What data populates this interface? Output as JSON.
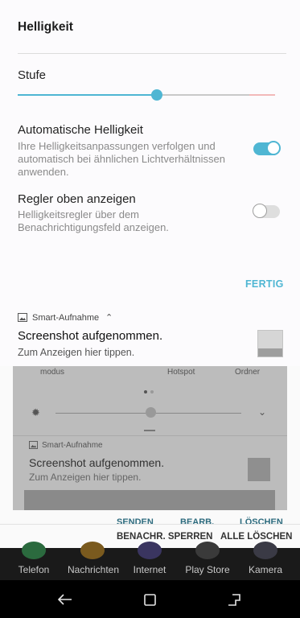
{
  "brightness": {
    "title": "Helligkeit",
    "level_label": "Stufe",
    "level": 0.55,
    "auto": {
      "label": "Automatische Helligkeit",
      "description": "Ihre Helligkeitsanpassungen verfolgen und automatisch bei ähnlichen Lichtverhältnissen anwenden.",
      "enabled": true
    },
    "top_slider": {
      "label": "Regler oben anzeigen",
      "description": "Helligkeitsregler über dem Benachrichtigungsfeld anzeigen.",
      "enabled": false
    },
    "done_label": "FERTIG"
  },
  "notification": {
    "app_name": "Smart-Aufnahme",
    "title": "Screenshot aufgenommen.",
    "text": "Zum Anzeigen hier tippen."
  },
  "shade_preview": {
    "tile_left": "modus",
    "tile_mid": "Hotspot",
    "tile_right": "Ordner",
    "app_name": "Smart-Aufnahme",
    "title": "Screenshot aufgenommen.",
    "text": "Zum Anzeigen hier tippen.",
    "actions": [
      "SENDEN",
      "BEARB.",
      "LÖSCHEN"
    ]
  },
  "actions": {
    "block": "BENACHR. SPERREN",
    "clear_all": "ALLE LÖSCHEN"
  },
  "dock": [
    "Telefon",
    "Nachrichten",
    "Internet",
    "Play Store",
    "Kamera"
  ],
  "colors": {
    "accent": "#4fb6d3",
    "title": "#1e1e1e",
    "description": "#8a8a8a",
    "shade": "#bcbcbc",
    "dock": "#1a1a1a",
    "navbar": "#000000"
  }
}
